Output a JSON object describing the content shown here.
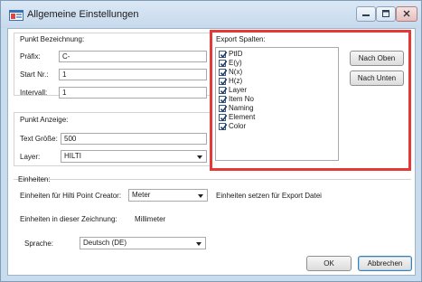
{
  "window": {
    "title": "Allgemeine Einstellungen"
  },
  "punkt_bezeichnung": {
    "legend": "Punkt Bezeichnung:",
    "praefix_label": "Präfix:",
    "praefix_value": "C-",
    "start_label": "Start Nr.:",
    "start_value": "1",
    "intervall_label": "Intervall:",
    "intervall_value": "1"
  },
  "punkt_anzeige": {
    "legend": "Punkt Anzeige:",
    "text_groesse_label": "Text Größe:",
    "text_groesse_value": "500",
    "layer_label": "Layer:",
    "layer_value": "HILTI"
  },
  "export_spalten": {
    "legend": "Export Spalten:",
    "items": [
      {
        "label": "PtID",
        "checked": true
      },
      {
        "label": "E(y)",
        "checked": true
      },
      {
        "label": "N(x)",
        "checked": true
      },
      {
        "label": "H(z)",
        "checked": true
      },
      {
        "label": "Layer",
        "checked": true
      },
      {
        "label": "Item No",
        "checked": true
      },
      {
        "label": "Naming",
        "checked": true
      },
      {
        "label": "Element",
        "checked": true
      },
      {
        "label": "Color",
        "checked": true
      }
    ],
    "nach_oben": "Nach Oben",
    "nach_unten": "Nach Unten",
    "highlight_color": "#e53935"
  },
  "einheiten": {
    "legend": "Einheiten:",
    "creator_label": "Einheiten für Hilti Point Creator:",
    "creator_value": "Meter",
    "export_label": "Einheiten setzen für Export Datei",
    "zeichnung_label": "Einheiten in dieser Zeichnung:",
    "zeichnung_value": "Millimeter"
  },
  "sprache": {
    "label": "Sprache:",
    "value": "Deutsch (DE)"
  },
  "footer": {
    "ok": "OK",
    "abbrechen": "Abbrechen"
  }
}
